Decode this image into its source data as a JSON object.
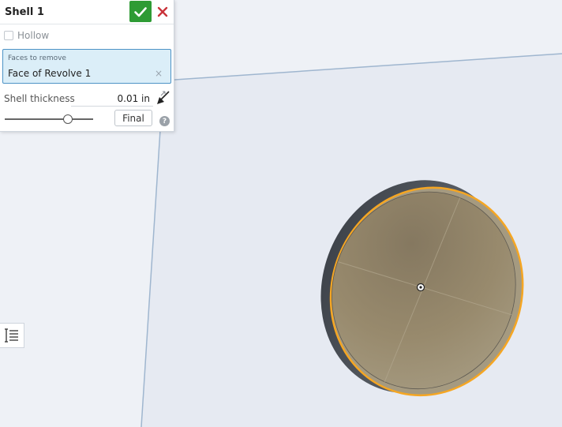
{
  "dialog": {
    "title": "Shell 1",
    "hollow_label": "Hollow",
    "hollow_checked": false,
    "faces_label": "Faces to remove",
    "faces_value": "Face of Revolve 1",
    "faces_clear": "×",
    "thickness_label": "Shell thickness",
    "thickness_value": "0.01 in",
    "slider_level": 0.7,
    "final_label": "Final",
    "help_label": "?"
  },
  "colors": {
    "accept": "#2e9b34",
    "cancel": "#c9333a",
    "selection_highlight": "#f5a623",
    "part_face": "#9a8a6c",
    "part_edge": "#4b5057",
    "plane_fill": "#e6eaf2",
    "plane_edge": "#9fb6cf"
  },
  "icons": {
    "accept": "check-icon",
    "cancel": "close-icon",
    "flip": "flip-direction-icon",
    "help": "help-icon",
    "feature_list": "feature-list-icon"
  }
}
